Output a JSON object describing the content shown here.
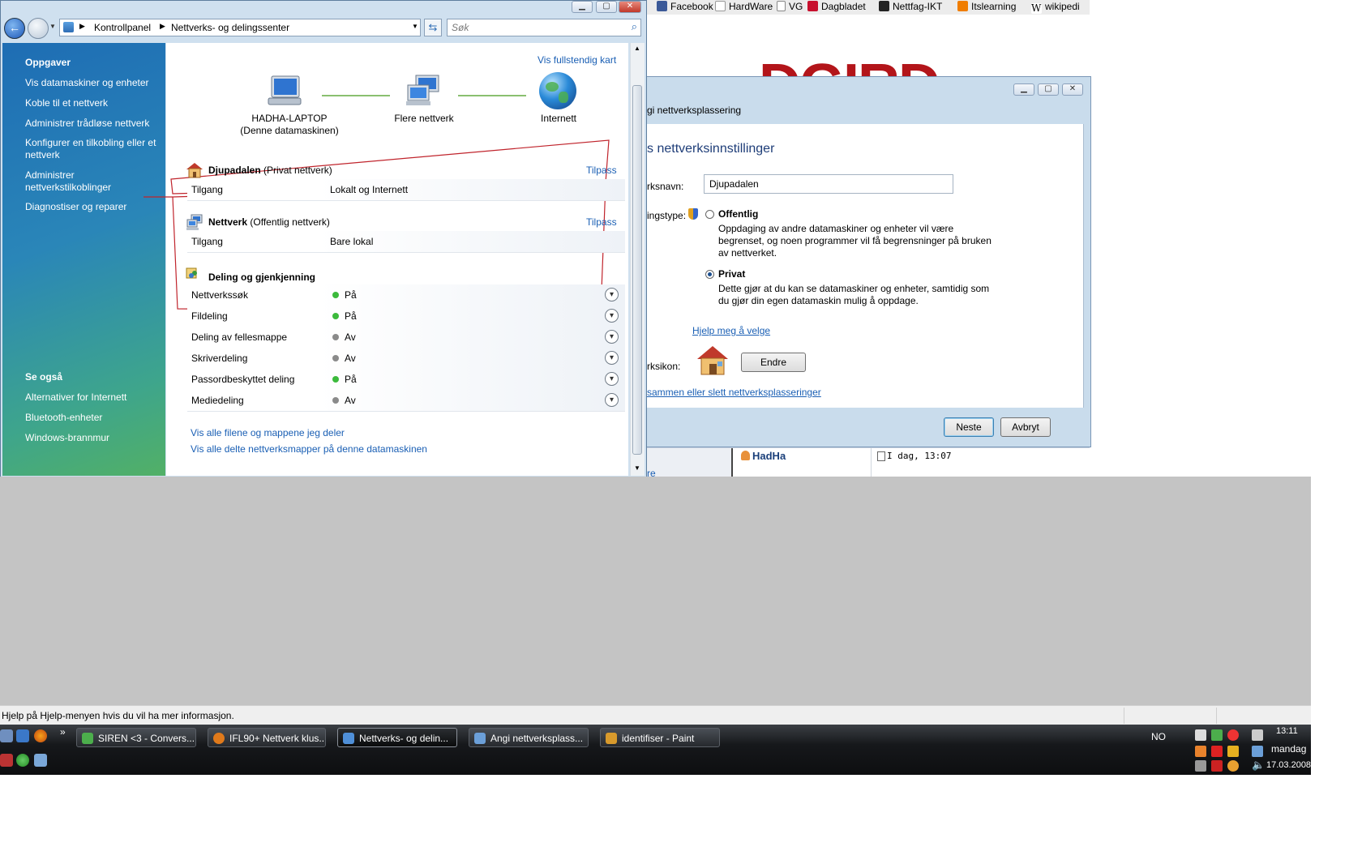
{
  "main_window": {
    "breadcrumb": [
      "Kontrollpanel",
      "Nettverks- og delingssenter"
    ],
    "search_placeholder": "Søk",
    "sidebar": {
      "tasks_heading": "Oppgaver",
      "tasks": [
        "Vis datamaskiner og enheter",
        "Koble til et nettverk",
        "Administrer trådløse nettverk",
        "Konfigurer en tilkobling eller et nettverk",
        "Administrer nettverkstilkoblinger",
        "Diagnostiser og reparer"
      ],
      "see_also_heading": "Se også",
      "see_also": [
        "Alternativer for Internett",
        "Bluetooth-enheter",
        "Windows-brannmur"
      ]
    },
    "map": {
      "full_map_link": "Vis fullstendig kart",
      "computer_name": "HADHA-LAPTOP",
      "computer_sub": "(Denne datamaskinen)",
      "networks_label": "Flere nettverk",
      "internet_label": "Internett"
    },
    "networks": [
      {
        "name": "Djupadalen",
        "type": "(Privat nettverk)",
        "customize": "Tilpass",
        "access_label": "Tilgang",
        "access_value": "Lokalt og Internett"
      },
      {
        "name": "Nettverk",
        "type": "(Offentlig nettverk)",
        "customize": "Tilpass",
        "access_label": "Tilgang",
        "access_value": "Bare lokal"
      }
    ],
    "sharing": {
      "heading": "Deling og gjenkjenning",
      "rows": [
        {
          "label": "Nettverkssøk",
          "value": "På",
          "color": "#3cba3c"
        },
        {
          "label": "Fildeling",
          "value": "På",
          "color": "#3cba3c"
        },
        {
          "label": "Deling av fellesmappe",
          "value": "Av",
          "color": "#8a8a8a"
        },
        {
          "label": "Skriverdeling",
          "value": "Av",
          "color": "#8a8a8a"
        },
        {
          "label": "Passordbeskyttet deling",
          "value": "På",
          "color": "#3cba3c"
        },
        {
          "label": "Mediedeling",
          "value": "Av",
          "color": "#8a8a8a"
        }
      ],
      "links": [
        "Vis alle filene og mappene jeg deler",
        "Vis alle delte nettverksmapper på denne datamaskinen"
      ]
    }
  },
  "browser": {
    "bookmarks": [
      "Facebook",
      "HardWare",
      "VG",
      "Dagbladet",
      "Nettfag-IKT",
      "Itslearning",
      "wikipedi"
    ],
    "forum_user": "HadHa",
    "forum_time": "I dag, 13:07",
    "footer_fragment": "re"
  },
  "dialog": {
    "title": "gi nettverksplassering",
    "heading": "s nettverksinnstillinger",
    "name_label": "rksnavn:",
    "name_value": "Djupadalen",
    "type_label": "ingstype:",
    "option_public": "Offentlig",
    "option_public_desc": "Oppdaging av andre datamaskiner og enheter vil være begrenset, og noen programmer vil få begrensninger på bruken av nettverket.",
    "option_private": "Privat",
    "option_private_desc": "Dette gjør at du kan se datamaskiner og enheter, samtidig som du gjør din egen datamaskin mulig å oppdage.",
    "help_link": "Hjelp meg å velge",
    "icon_label": "rksikon:",
    "change_button": "Endre",
    "merge_link": "sammen eller slett nettverksplasseringer",
    "next_button": "Neste",
    "cancel_button": "Avbryt"
  },
  "status_text": "Hjelp på Hjelp-menyen hvis du vil ha mer informasjon.",
  "taskbar": {
    "buttons": [
      "SIREN <3 - Convers...",
      "IFL90+ Nettverk klus...",
      "Nettverks- og delin...",
      "Angi nettverksplass...",
      "identifiser - Paint"
    ],
    "language": "NO",
    "time": "13:11",
    "day": "mandag",
    "date": "17.03.2008"
  }
}
